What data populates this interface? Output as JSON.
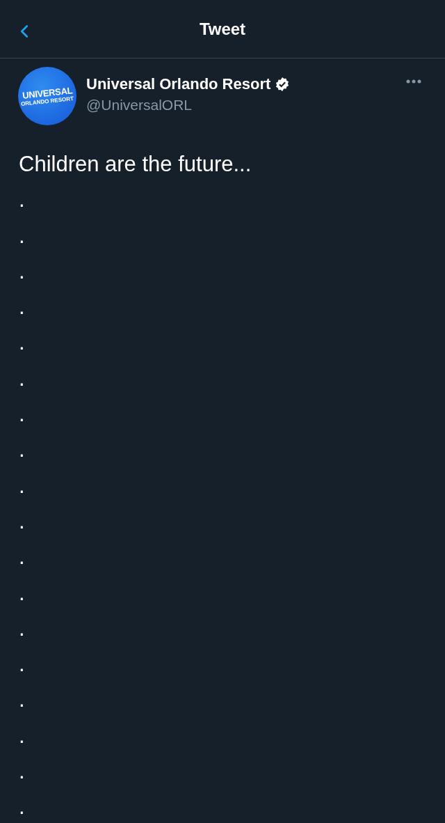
{
  "header": {
    "title": "Tweet"
  },
  "author": {
    "name": "Universal Orlando Resort",
    "verified": true,
    "handle": "@UniversalORL",
    "avatar_logo": [
      "UNIVERSAL",
      "ORLANDO RESORT"
    ]
  },
  "tweet": {
    "lines": [
      "Children are the future...",
      ".",
      ".",
      ".",
      ".",
      ".",
      ".",
      ".",
      ".",
      ".",
      ".",
      ".",
      ".",
      ".",
      ".",
      ".",
      ".",
      ".",
      "."
    ]
  }
}
